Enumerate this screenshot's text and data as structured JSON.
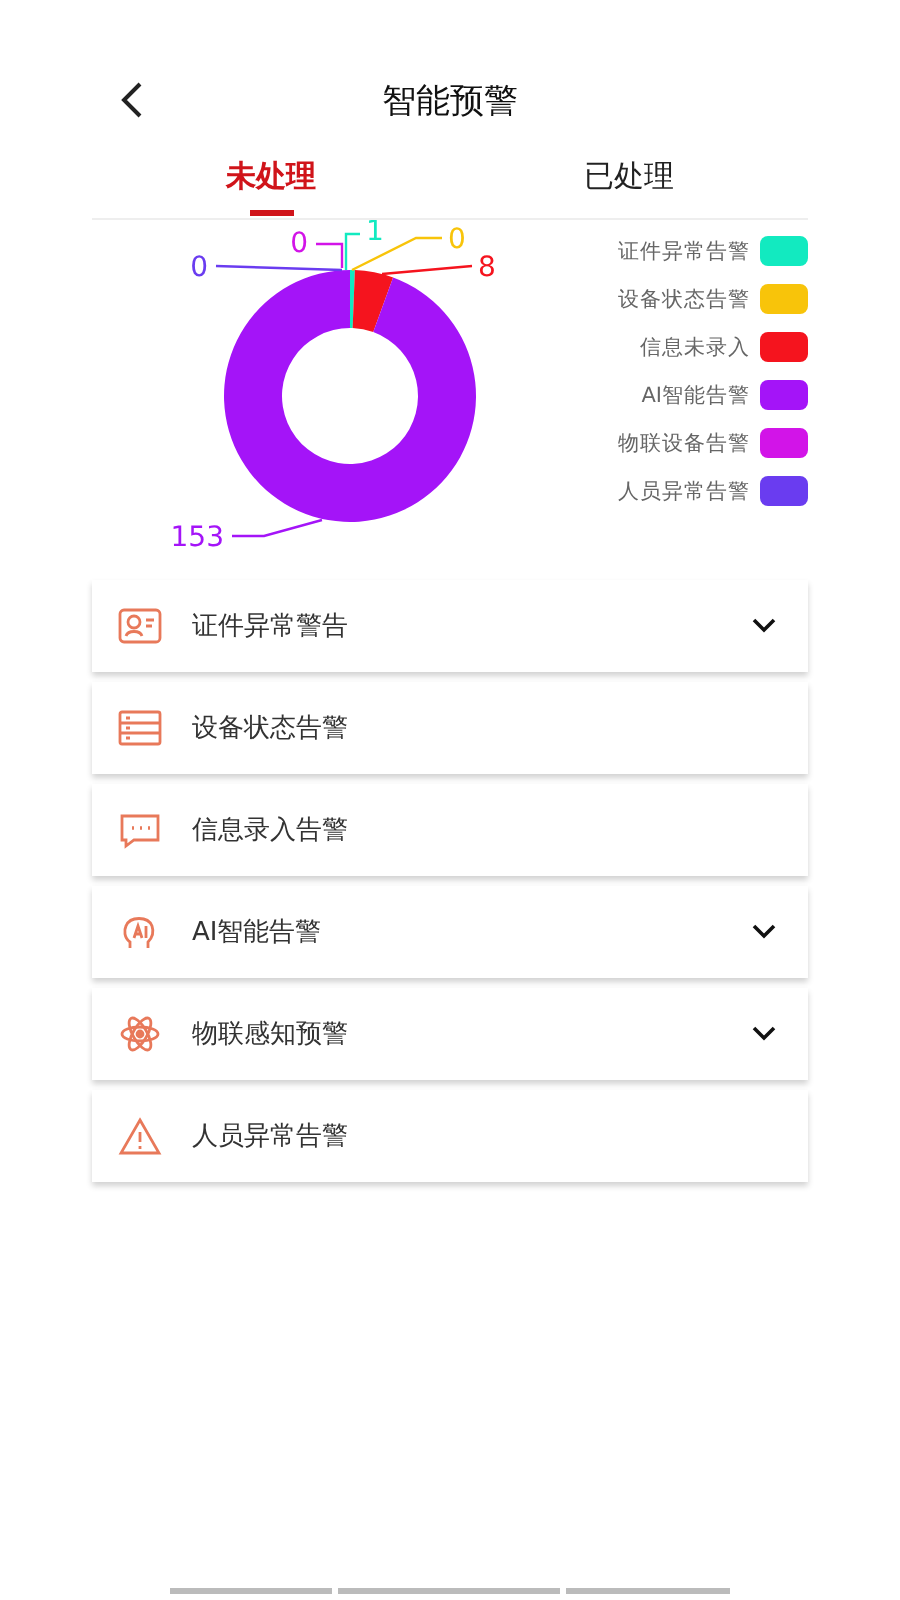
{
  "header": {
    "title": "智能预警"
  },
  "tabs": [
    {
      "label": "未处理",
      "selected": true
    },
    {
      "label": "已处理",
      "selected": false
    }
  ],
  "chart": {
    "chart_data": {
      "type": "donut",
      "categories": [
        "证件异常告警",
        "设备状态告警",
        "信息未录入",
        "AI智能告警",
        "物联设备告警",
        "人员异常告警"
      ],
      "values": [
        1,
        0,
        8,
        153,
        0,
        0
      ],
      "value_labels": [
        "1",
        "0",
        "8",
        "153",
        "0",
        "0"
      ]
    },
    "legend": [
      {
        "color": "#12eac0"
      },
      {
        "color": "#f8c40a"
      },
      {
        "color": "#f5141e"
      },
      {
        "color": "#a414f8"
      },
      {
        "color": "#d214e8"
      },
      {
        "color": "#6a3cf0"
      }
    ]
  },
  "alerts": [
    {
      "kind": "id-card",
      "label": "证件异常警告",
      "expandable": true
    },
    {
      "kind": "list",
      "label": "设备状态告警",
      "expandable": false
    },
    {
      "kind": "chat",
      "label": "信息录入告警",
      "expandable": false
    },
    {
      "kind": "ai",
      "label": "AI智能告警",
      "expandable": true
    },
    {
      "kind": "atom",
      "label": "物联感知预警",
      "expandable": true
    },
    {
      "kind": "warning",
      "label": "人员异常告警",
      "expandable": false
    }
  ]
}
